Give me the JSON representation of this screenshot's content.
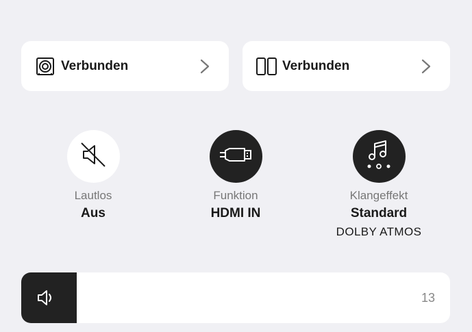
{
  "devices": [
    {
      "icon": "subwoofer-icon",
      "status": "Verbunden"
    },
    {
      "icon": "rear-speakers-icon",
      "status": "Verbunden"
    }
  ],
  "controls": {
    "mute": {
      "icon": "mute-icon",
      "title": "Lautlos",
      "value": "Aus"
    },
    "function": {
      "icon": "hdmi-icon",
      "title": "Funktion",
      "value": "HDMI IN"
    },
    "sound_effect": {
      "icon": "music-notes-icon",
      "title": "Klangeffekt",
      "value": "Standard",
      "sub": "DOLBY ATMOS"
    }
  },
  "volume": {
    "icon": "speaker-icon",
    "value": "13",
    "level_fraction": 0.13
  },
  "colors": {
    "background": "#f0f0f4",
    "card": "#ffffff",
    "dark": "#222222",
    "muted_text": "#777777"
  }
}
